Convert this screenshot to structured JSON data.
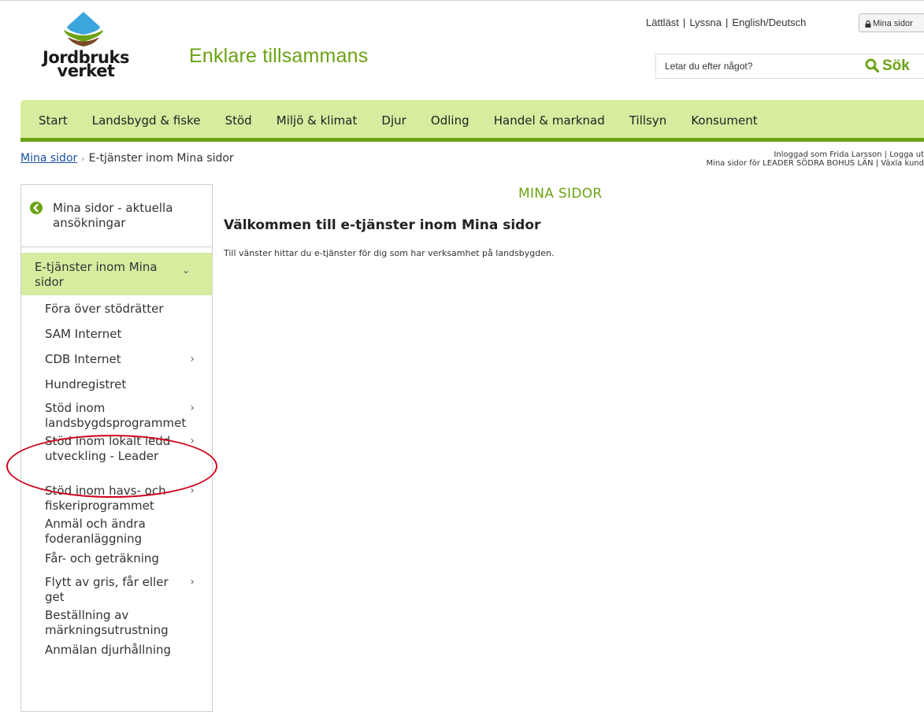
{
  "logo": {
    "line1": "Jordbruks",
    "line2": "verket",
    "colors": {
      "sky": "#3ba6de",
      "leaf": "#6ba213",
      "soil": "#7a4a24"
    }
  },
  "slogan": "Enklare tillsammans",
  "toplinks": [
    "Lättläst",
    "Lyssna",
    "English/Deutsch"
  ],
  "mina_sidor_button": {
    "label": "Mina sidor",
    "icon": "lock-icon"
  },
  "search": {
    "placeholder": "Letar du efter något?",
    "button_label": "Sök",
    "icon": "search-icon"
  },
  "mainnav": [
    "Start",
    "Landsbygd & fiske",
    "Stöd",
    "Miljö & klimat",
    "Djur",
    "Odling",
    "Handel & marknad",
    "Tillsyn",
    "Konsument"
  ],
  "breadcrumb": {
    "root": "Mina sidor",
    "separator": "›",
    "current": "E-tjänster inom Mina sidor"
  },
  "userinfo": {
    "line1": "Inloggad som Frida Larsson | Logga ut",
    "line2": "Mina sidor för LEADER SÖDRA BOHUS LÄN | Växla kund"
  },
  "sidebar": {
    "back": {
      "label": "Mina sidor - aktuella ansökningar",
      "icon": "arrow-left-circle-icon"
    },
    "section": {
      "label": "E-tjänster inom Mina sidor",
      "chevron": "⌄"
    },
    "items": [
      {
        "label": "Föra över stödrätter",
        "has_children": false
      },
      {
        "label": "SAM Internet",
        "has_children": false
      },
      {
        "label": "CDB Internet",
        "has_children": true
      },
      {
        "label": "Hundregistret",
        "has_children": false
      },
      {
        "label": "Stöd inom landsbygdsprogrammet",
        "has_children": true
      },
      {
        "label": "Stöd inom lokalt ledd utveckling - Leader",
        "has_children": true
      },
      {
        "label": "Stöd inom havs- och fiskeriprogrammet",
        "has_children": true
      },
      {
        "label": "Anmäl och ändra foderanläggning",
        "has_children": false
      },
      {
        "label": "Får- och geträkning",
        "has_children": false
      },
      {
        "label": "Flytt av gris, får eller get",
        "has_children": true
      },
      {
        "label": "Beställning av märkningsutrustning",
        "has_children": false
      },
      {
        "label": "Anmälan djurhållning",
        "has_children": false
      }
    ],
    "chevron": "›"
  },
  "main": {
    "kicker": "MINA SIDOR",
    "title": "Välkommen till e-tjänster inom Mina sidor",
    "text": "Till vänster hittar du e-tjänster för dig som har verksamhet på landsbygden."
  },
  "colors": {
    "accent": "#6ba213",
    "nav_bg": "#d6ed9f",
    "link": "#1a4ea0",
    "annotation": "#d0021b"
  }
}
